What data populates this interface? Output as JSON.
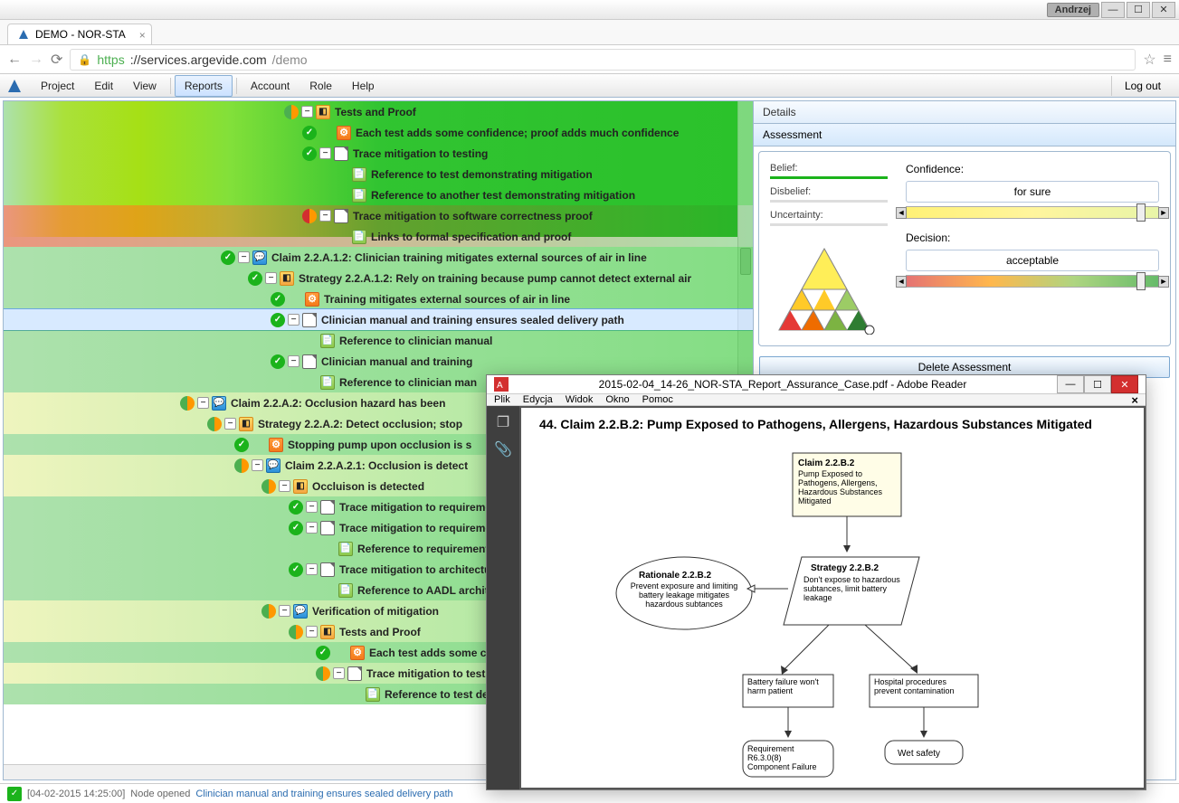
{
  "os": {
    "user": "Andrzej"
  },
  "browser": {
    "tab_title": "DEMO - NOR-STA",
    "url_scheme": "https",
    "url_host": "://services.argevide.com",
    "url_path": "/demo"
  },
  "menu": {
    "project": "Project",
    "edit": "Edit",
    "view": "View",
    "reports": "Reports",
    "account": "Account",
    "role": "Role",
    "help": "Help",
    "logout": "Log out"
  },
  "tree": [
    {
      "indent": 310,
      "bg": "rowbg-green",
      "icons": [
        "halfgreen",
        "collapse",
        "strat"
      ],
      "text": "Tests and Proof"
    },
    {
      "indent": 330,
      "bg": "rowbg-green",
      "icons": [
        "green",
        "blank",
        "gear"
      ],
      "text": "Each test adds some confidence; proof adds much confidence"
    },
    {
      "indent": 330,
      "bg": "rowbg-green",
      "icons": [
        "green",
        "collapse",
        "doc"
      ],
      "text": "Trace mitigation to testing"
    },
    {
      "indent": 385,
      "bg": "rowbg-green",
      "icons": [
        "ref"
      ],
      "text": "Reference to test demonstrating mitigation"
    },
    {
      "indent": 385,
      "bg": "rowbg-green",
      "icons": [
        "ref"
      ],
      "text": "Reference to another test demonstrating mitigation"
    },
    {
      "indent": 330,
      "bg": "rowbg-red",
      "icons": [
        "halfred",
        "collapse",
        "doc"
      ],
      "text": "Trace mitigation to software correctness proof"
    },
    {
      "indent": 385,
      "bg": "rowbg-red",
      "icons": [
        "ref"
      ],
      "text": "Links to formal specification and proof"
    },
    {
      "indent": 240,
      "bg": "rowbg-green",
      "icons": [
        "green",
        "collapse",
        "claim"
      ],
      "text": "Claim 2.2.A.1.2: Clinician training mitigates external sources of air in line"
    },
    {
      "indent": 270,
      "bg": "rowbg-green",
      "icons": [
        "green",
        "collapse",
        "strat"
      ],
      "text": "Strategy 2.2.A.1.2: Rely on training because pump cannot detect external air"
    },
    {
      "indent": 295,
      "bg": "rowbg-green",
      "icons": [
        "green",
        "blank",
        "gear"
      ],
      "text": "Training mitigates external sources of air in line"
    },
    {
      "indent": 295,
      "bg": "selected",
      "icons": [
        "green",
        "collapse",
        "doc"
      ],
      "text": "Clinician manual and training ensures sealed delivery path"
    },
    {
      "indent": 350,
      "bg": "rowbg-green",
      "icons": [
        "ref"
      ],
      "text": "Reference to clinician manual"
    },
    {
      "indent": 295,
      "bg": "rowbg-green",
      "icons": [
        "green",
        "collapse",
        "doc"
      ],
      "text": "Clinician manual and training"
    },
    {
      "indent": 350,
      "bg": "rowbg-green",
      "icons": [
        "ref"
      ],
      "text": "Reference to clinician man"
    },
    {
      "indent": 195,
      "bg": "rowbg-ygreen",
      "icons": [
        "halfgreen",
        "collapse",
        "claim"
      ],
      "text": "Claim 2.2.A.2: Occlusion hazard has been"
    },
    {
      "indent": 225,
      "bg": "rowbg-ygreen",
      "icons": [
        "halfgreen",
        "collapse",
        "strat"
      ],
      "text": "Strategy 2.2.A.2: Detect occlusion; stop"
    },
    {
      "indent": 255,
      "bg": "rowbg-green",
      "icons": [
        "green",
        "blank",
        "gear"
      ],
      "text": "Stopping pump upon occlusion is s"
    },
    {
      "indent": 255,
      "bg": "rowbg-ygreen",
      "icons": [
        "halfgreen",
        "collapse",
        "claim"
      ],
      "text": "Claim 2.2.A.2.1: Occlusion is detect"
    },
    {
      "indent": 285,
      "bg": "rowbg-ygreen",
      "icons": [
        "halfgreen",
        "collapse",
        "strat"
      ],
      "text": "Occluison is detected"
    },
    {
      "indent": 315,
      "bg": "rowbg-green",
      "icons": [
        "green",
        "collapse",
        "doc"
      ],
      "text": "Trace mitigation to requireme"
    },
    {
      "indent": 315,
      "bg": "rowbg-green",
      "icons": [
        "green",
        "collapse",
        "doc"
      ],
      "text": "Trace mitigation to requireme"
    },
    {
      "indent": 370,
      "bg": "rowbg-green",
      "icons": [
        "ref"
      ],
      "text": "Reference to requirements"
    },
    {
      "indent": 315,
      "bg": "rowbg-green",
      "icons": [
        "green",
        "collapse",
        "doc"
      ],
      "text": "Trace mitigation to architectu"
    },
    {
      "indent": 370,
      "bg": "rowbg-green",
      "icons": [
        "ref"
      ],
      "text": "Reference to AADL archite"
    },
    {
      "indent": 285,
      "bg": "rowbg-ygreen",
      "icons": [
        "halfgreen",
        "collapse",
        "claim"
      ],
      "text": "Verification of mitigation"
    },
    {
      "indent": 315,
      "bg": "rowbg-ygreen",
      "icons": [
        "halfgreen",
        "collapse",
        "strat"
      ],
      "text": "Tests and Proof"
    },
    {
      "indent": 345,
      "bg": "rowbg-green",
      "icons": [
        "green",
        "blank",
        "gear"
      ],
      "text": "Each test adds some co"
    },
    {
      "indent": 345,
      "bg": "rowbg-ygreen",
      "icons": [
        "halfgreen",
        "collapse",
        "doc"
      ],
      "text": "Trace mitigation to test"
    },
    {
      "indent": 400,
      "bg": "rowbg-green",
      "icons": [
        "ref"
      ],
      "text": "Reference to test dem"
    }
  ],
  "details": {
    "header": "Details",
    "assessment": "Assessment"
  },
  "assess": {
    "belief": "Belief:",
    "disbelief": "Disbelief:",
    "uncertainty": "Uncertainty:",
    "confidence": "Confidence:",
    "conf_value": "for sure",
    "decision": "Decision:",
    "dec_value": "acceptable",
    "delete": "Delete Assessment"
  },
  "pdf": {
    "title": "2015-02-04_14-26_NOR-STA_Report_Assurance_Case.pdf - Adobe Reader",
    "menu": {
      "file": "Plik",
      "edit": "Edycja",
      "view": "Widok",
      "window": "Okno",
      "help": "Pomoc"
    },
    "heading": "44. Claim 2.2.B.2: Pump Exposed to Pathogens, Allergens, Hazardous Substances Mitigated",
    "nodes": {
      "claim_title": "Claim 2.2.B.2",
      "claim_body": "Pump Exposed to Pathogens, Allergens, Hazardous Substances Mitigated",
      "rat_title": "Rationale 2.2.B.2",
      "rat_body": "Prevent exposure and limiting battery leakage mitigates hazardous subtances",
      "strat_title": "Strategy 2.2.B.2",
      "strat_body": "Don't expose to hazardous subtances, limit battery leakage",
      "battery": "Battery failure won't harm patient",
      "hospital": "Hospital procedures prevent contamination",
      "req_title": "Requirement R6.3.0(8)",
      "req_body": "Component Failure",
      "wet": "Wet safety"
    }
  },
  "status": {
    "ts": "[04-02-2015 14:25:00]",
    "msg": "Node opened",
    "link": "Clinician manual and training ensures sealed delivery path"
  }
}
